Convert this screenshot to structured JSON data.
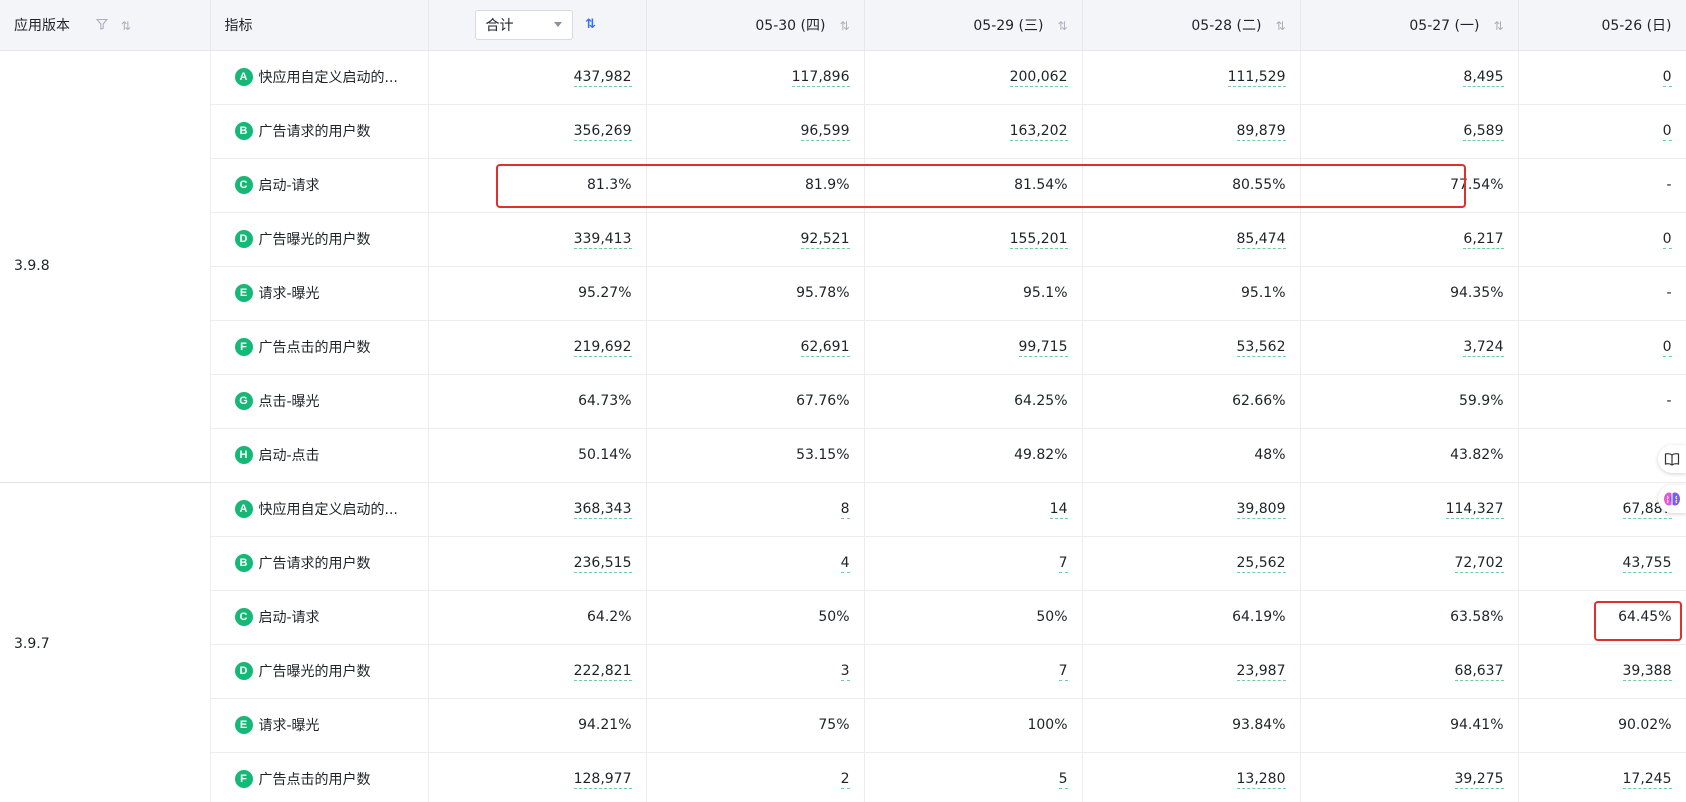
{
  "header": {
    "version_col": "应用版本",
    "metric_col": "指标",
    "total_select": "合计",
    "dates": [
      "05-30 (四)",
      "05-29 (三)",
      "05-28 (二)",
      "05-27 (一)",
      "05-26 (日)"
    ]
  },
  "groups": [
    {
      "version": "3.9.8",
      "rows": [
        {
          "badge": "A",
          "label": "快应用自定义启动的...",
          "total": "437,982",
          "v": [
            "117,896",
            "200,062",
            "111,529",
            "8,495",
            "0"
          ]
        },
        {
          "badge": "B",
          "label": "广告请求的用户数",
          "total": "356,269",
          "v": [
            "96,599",
            "163,202",
            "89,879",
            "6,589",
            "0"
          ]
        },
        {
          "badge": "C",
          "label": "启动-请求",
          "total": "81.3%",
          "v": [
            "81.9%",
            "81.54%",
            "80.55%",
            "77.54%",
            "-"
          ]
        },
        {
          "badge": "D",
          "label": "广告曝光的用户数",
          "total": "339,413",
          "v": [
            "92,521",
            "155,201",
            "85,474",
            "6,217",
            "0"
          ]
        },
        {
          "badge": "E",
          "label": "请求-曝光",
          "total": "95.27%",
          "v": [
            "95.78%",
            "95.1%",
            "95.1%",
            "94.35%",
            "-"
          ]
        },
        {
          "badge": "F",
          "label": "广告点击的用户数",
          "total": "219,692",
          "v": [
            "62,691",
            "99,715",
            "53,562",
            "3,724",
            "0"
          ]
        },
        {
          "badge": "G",
          "label": "点击-曝光",
          "total": "64.73%",
          "v": [
            "67.76%",
            "64.25%",
            "62.66%",
            "59.9%",
            "-"
          ]
        },
        {
          "badge": "H",
          "label": "启动-点击",
          "total": "50.14%",
          "v": [
            "53.15%",
            "49.82%",
            "48%",
            "43.82%",
            "-"
          ]
        }
      ]
    },
    {
      "version": "3.9.7",
      "rows": [
        {
          "badge": "A",
          "label": "快应用自定义启动的...",
          "total": "368,343",
          "v": [
            "8",
            "14",
            "39,809",
            "114,327",
            "67,887"
          ]
        },
        {
          "badge": "B",
          "label": "广告请求的用户数",
          "total": "236,515",
          "v": [
            "4",
            "7",
            "25,562",
            "72,702",
            "43,755"
          ]
        },
        {
          "badge": "C",
          "label": "启动-请求",
          "total": "64.2%",
          "v": [
            "50%",
            "50%",
            "64.19%",
            "63.58%",
            "64.45%"
          ]
        },
        {
          "badge": "D",
          "label": "广告曝光的用户数",
          "total": "222,821",
          "v": [
            "3",
            "7",
            "23,987",
            "68,637",
            "39,388"
          ]
        },
        {
          "badge": "E",
          "label": "请求-曝光",
          "total": "94.21%",
          "v": [
            "75%",
            "100%",
            "93.84%",
            "94.41%",
            "90.02%"
          ]
        },
        {
          "badge": "F",
          "label": "广告点击的用户数",
          "total": "128,977",
          "v": [
            "2",
            "5",
            "13,280",
            "39,275",
            "17,245"
          ]
        }
      ]
    }
  ],
  "colors": {
    "badge": "#16b877",
    "highlight": "#e0302b",
    "header_bg": "#f3f5f9",
    "link_underline": "#6fcf9e"
  },
  "icons": [
    "filter-icon",
    "sort-icon",
    "sort-active-icon",
    "dropdown-caret-icon",
    "book-icon",
    "brain-icon"
  ]
}
